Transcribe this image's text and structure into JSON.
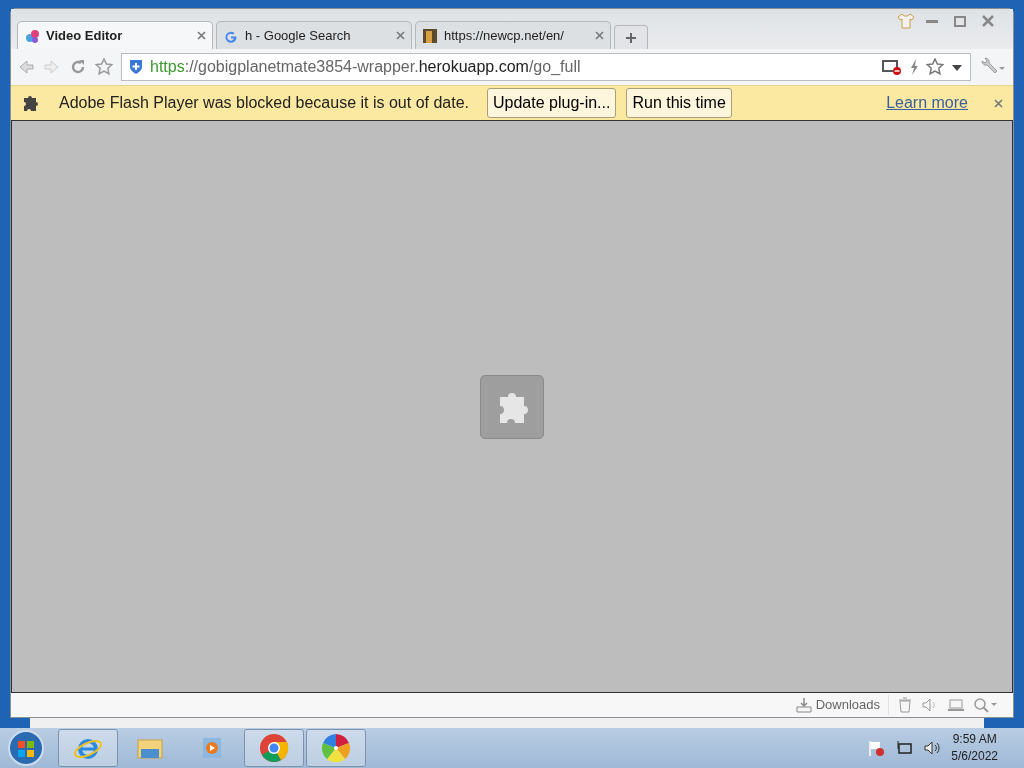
{
  "tabs": [
    {
      "title": "Video Editor",
      "selected": true,
      "kind": "colorful"
    },
    {
      "title": "h - Google Search",
      "selected": false,
      "kind": "google"
    },
    {
      "title": "https://newcp.net/en/",
      "selected": false,
      "kind": "photo"
    }
  ],
  "address": {
    "scheme": "https",
    "host_prefix": "://gobigplanetmate3854-wrapper.",
    "domain": "herokuapp.com",
    "path": "/go_full"
  },
  "infobar": {
    "message": "Adobe Flash Player was blocked because it is out of date.",
    "buttons": [
      "Update plug-in...",
      "Run this time"
    ],
    "link": "Learn more"
  },
  "status_bar": {
    "downloads": "Downloads"
  },
  "taskbar": {
    "apps": [
      {
        "kind": "ie",
        "active": true
      },
      {
        "kind": "folder",
        "active": false
      },
      {
        "kind": "media",
        "active": false
      },
      {
        "kind": "chrome",
        "active": true
      },
      {
        "kind": "pinwheel",
        "active": true
      }
    ],
    "time": "9:59 AM",
    "date": "5/6/2022"
  }
}
